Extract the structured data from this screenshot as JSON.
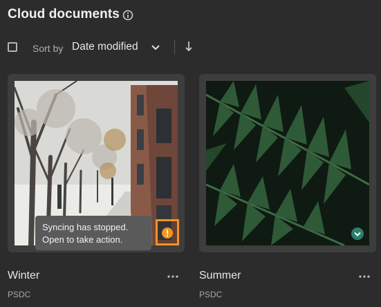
{
  "header": {
    "title": "Cloud documents",
    "info_icon": "info-icon"
  },
  "toolbar": {
    "sort_by_label": "Sort by",
    "sort_value": "Date modified",
    "sort_direction_icon": "arrow-down-icon"
  },
  "colors": {
    "background": "#2c2c2c",
    "card": "#3d3d3d",
    "warning": "#f29423",
    "synced": "#2e7d6b"
  },
  "documents": [
    {
      "name": "Winter",
      "type": "PSDC",
      "status_icon": "warning-icon",
      "tooltip": {
        "line1": "Syncing has stopped.",
        "line2": "Open to take action."
      }
    },
    {
      "name": "Summer",
      "type": "PSDC",
      "status_icon": "synced-check-icon"
    }
  ]
}
